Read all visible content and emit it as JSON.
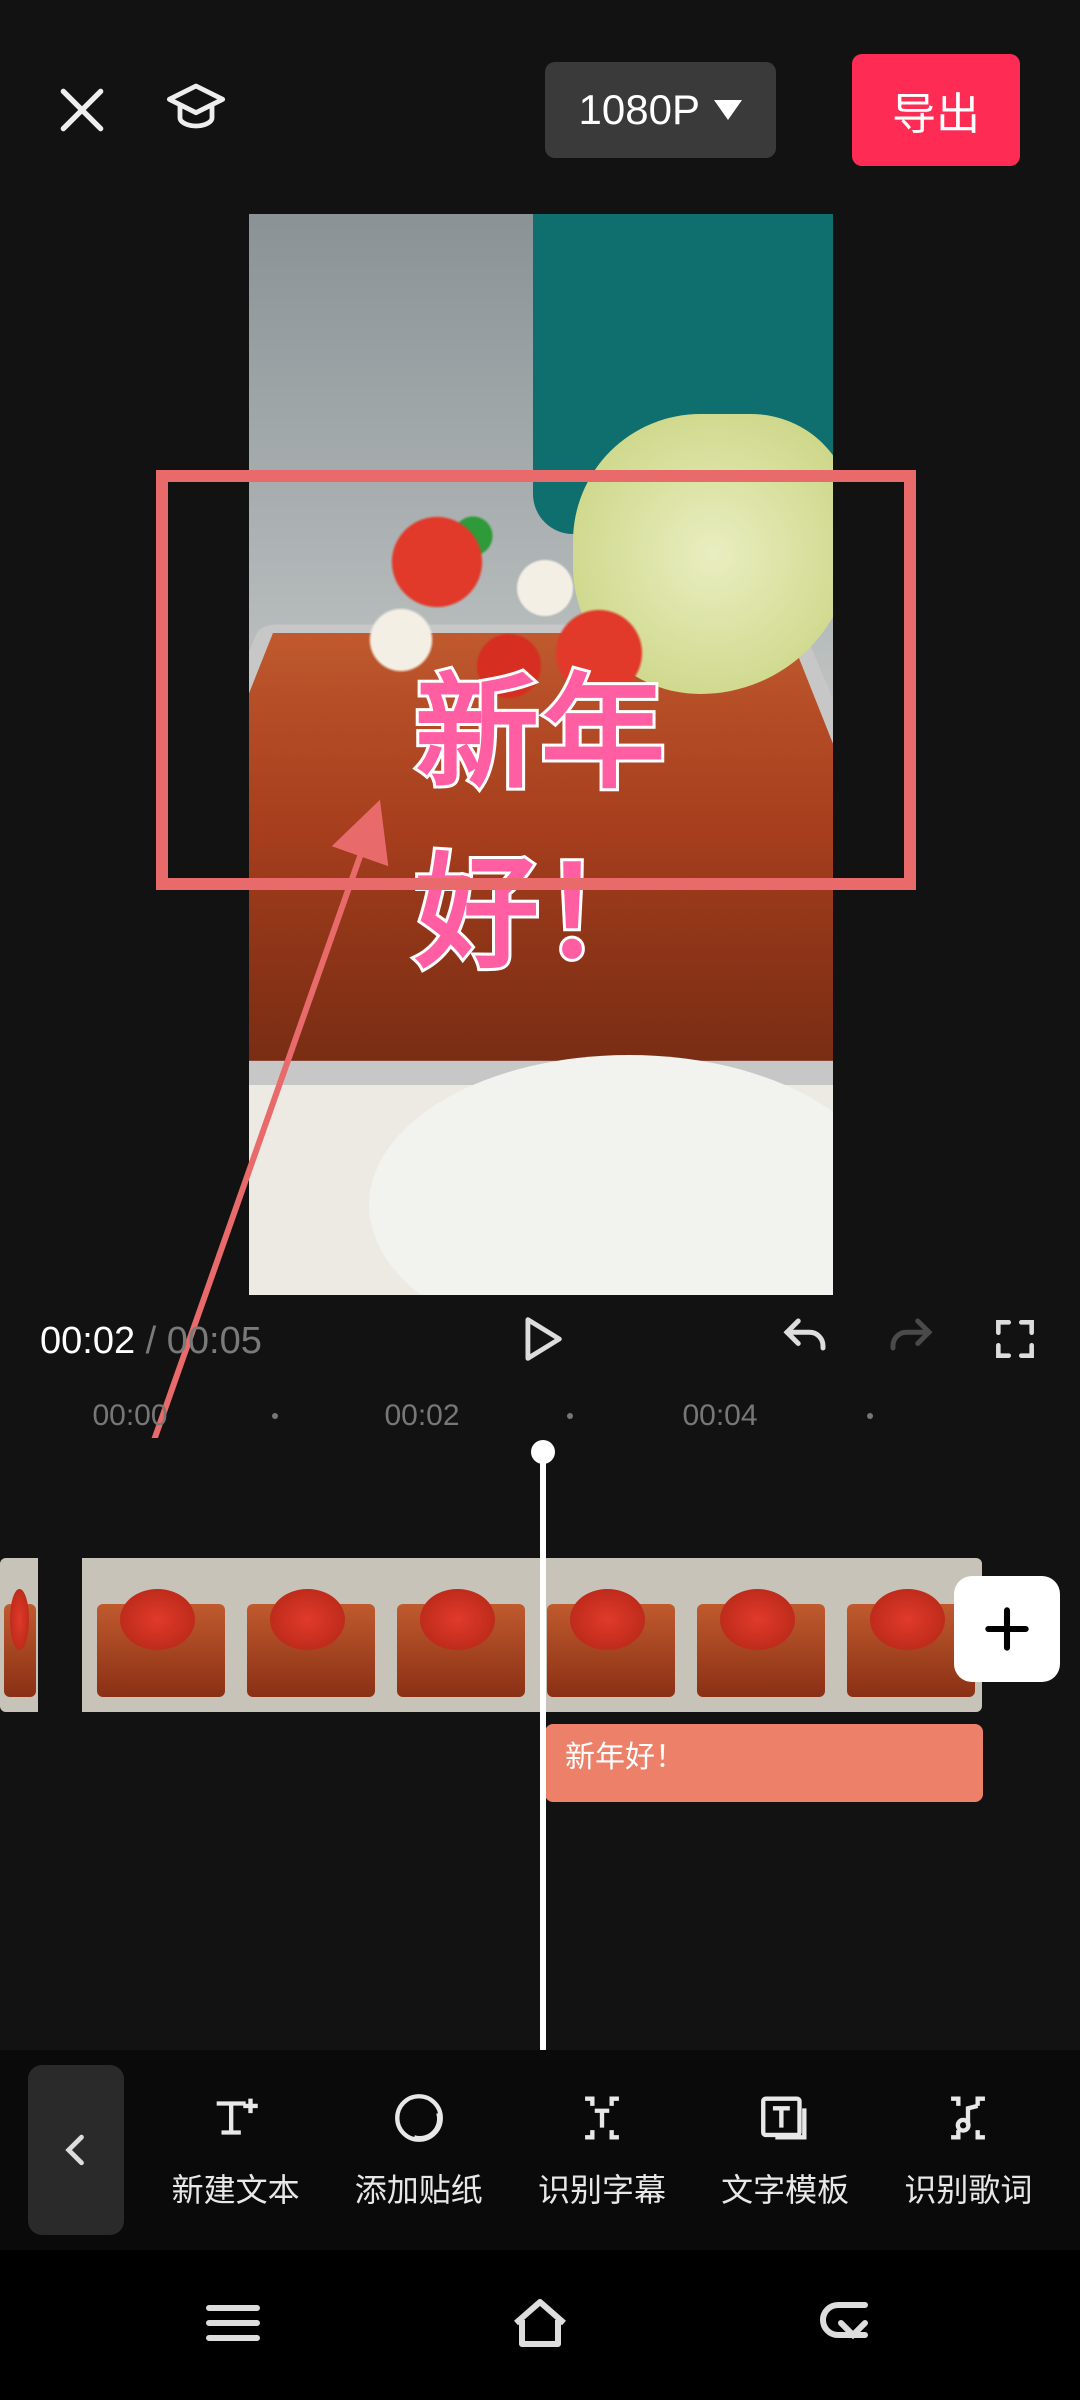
{
  "topbar": {
    "resolution_label": "1080P",
    "export_label": "导出"
  },
  "preview": {
    "overlay_text": "新年好！"
  },
  "playback": {
    "current": "00:02",
    "separator": " / ",
    "duration": "00:05"
  },
  "ruler": {
    "ticks": [
      "00:00",
      "00:02",
      "00:04"
    ]
  },
  "timeline": {
    "text_clip_label": "新年好！"
  },
  "toolbar": {
    "items": [
      {
        "id": "new-text",
        "label": "新建文本"
      },
      {
        "id": "add-sticker",
        "label": "添加贴纸"
      },
      {
        "id": "auto-captions",
        "label": "识别字幕"
      },
      {
        "id": "text-templates",
        "label": "文字模板"
      },
      {
        "id": "auto-lyrics",
        "label": "识别歌词"
      }
    ]
  }
}
